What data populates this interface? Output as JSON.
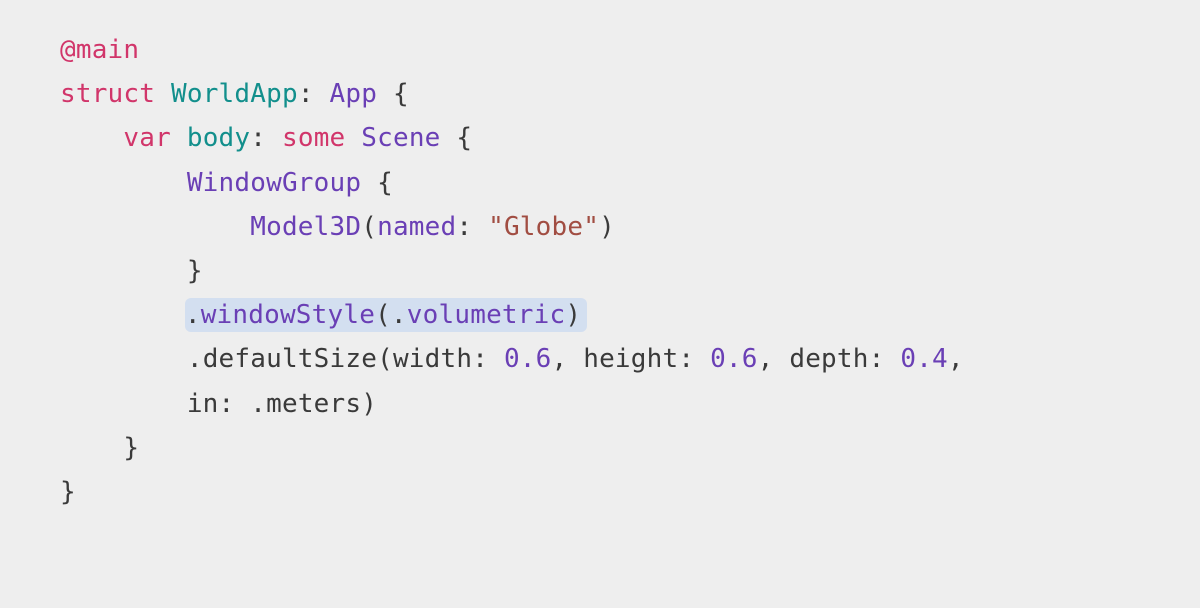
{
  "code": {
    "atMain": "@main",
    "struct": "struct",
    "worldApp": "WorldApp",
    "colon1": ": ",
    "appType": "App",
    "openBrace1": " {",
    "varKw": "var",
    "bodyId": "body",
    "colon2": ": ",
    "someKw": "some",
    "sceneType": "Scene",
    "openBrace2": " {",
    "windowGroup": "WindowGroup",
    "openBrace3": " {",
    "model3D": "Model3D",
    "openParen1": "(",
    "namedLabel": "named",
    "colon3": ": ",
    "globeStr": "\"Globe\"",
    "closeParen1": ")",
    "closeBrace1": "}",
    "dot1": ".",
    "windowStyle": "windowStyle",
    "openParen2": "(.",
    "volumetric": "volumetric",
    "closeParen2": ")",
    "dot2": ".",
    "defaultSize": "defaultSize",
    "openParen3": "(",
    "widthLabel": "width",
    "colon4": ": ",
    "widthVal": "0.6",
    "comma1": ", ",
    "heightLabel": "height",
    "colon5": ": ",
    "heightVal": "0.6",
    "comma2": ", ",
    "depthLabel": "depth",
    "colon6": ": ",
    "depthVal": "0.4",
    "comma3": ",",
    "inLabel": "in",
    "colon7": ": .",
    "meters": "meters",
    "closeParen3": ")",
    "closeBrace2": "}",
    "closeBrace3": "}"
  }
}
